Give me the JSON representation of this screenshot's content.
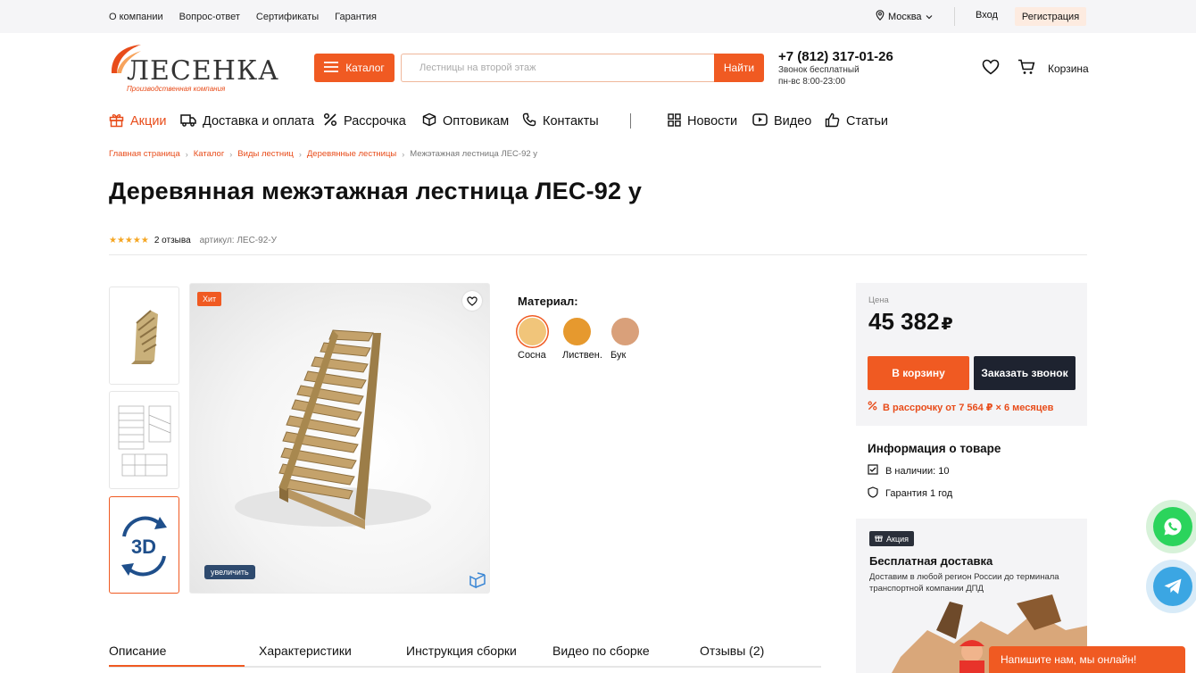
{
  "topbar": {
    "links": [
      "О компании",
      "Вопрос-ответ",
      "Сертификаты",
      "Гарантия"
    ],
    "city": "Москва",
    "login": "Вход",
    "register": "Регистрация"
  },
  "logo": {
    "brand": "ЛЕСЕНКА",
    "subtitle": "Производственная компания"
  },
  "header": {
    "catalog_label": "Каталог",
    "search_placeholder": "Лестницы на второй этаж",
    "search_button": "Найти",
    "phone": "+7 (812) 317-01-26",
    "phone_note": "Звонок бесплатный",
    "hours": "пн-вс 8:00-23:00",
    "cart_label": "Корзина"
  },
  "nav": {
    "left": [
      "Акции",
      "Доставка и оплата",
      "Рассрочка",
      "Оптовикам",
      "Контакты"
    ],
    "right": [
      "Новости",
      "Видео",
      "Статьи"
    ]
  },
  "breadcrumbs": [
    "Главная страница",
    "Каталог",
    "Виды лестниц",
    "Деревянные лестницы",
    "Межэтажная лестница ЛЕС-92 у"
  ],
  "product": {
    "title": "Деревянная межэтажная лестница ЛЕС-92 у",
    "stars": "★★★★★",
    "reviews": "2 отзыва",
    "sku": "артикул: ЛЕС-92-У",
    "badge": "Хит",
    "zoom_label": "увеличить",
    "thumb_3d_label": "3D"
  },
  "material": {
    "label": "Материал:",
    "options": [
      {
        "name": "Сосна",
        "color": "#f1c57a",
        "selected": true
      },
      {
        "name": "Листвен.",
        "color": "#e6992e",
        "selected": false
      },
      {
        "name": "Бук",
        "color": "#d9a07a",
        "selected": false
      }
    ]
  },
  "price": {
    "label": "Цена",
    "value": "45 382",
    "currency": "₽",
    "cart_button": "В корзину",
    "call_button": "Заказать звонок",
    "installment": "В рассрочку от 7 564 ₽ × 6 месяцев"
  },
  "info": {
    "heading": "Информация о товаре",
    "stock": "В наличии: 10",
    "warranty": "Гарантия 1 год"
  },
  "promo": {
    "tag": "Акция",
    "heading": "Бесплатная доставка",
    "text": "Доставим в любой регион России до терминала транспортной компании ДПД"
  },
  "tabs": [
    "Описание",
    "Характеристики",
    "Инструкция сборки",
    "Видео по сборке",
    "Отзывы (2)"
  ],
  "chat": {
    "label": "Напишите нам, мы онлайн!"
  },
  "colors": {
    "accent": "#f05a22",
    "dark_button": "#1e2330",
    "stars": "#f5a623"
  }
}
